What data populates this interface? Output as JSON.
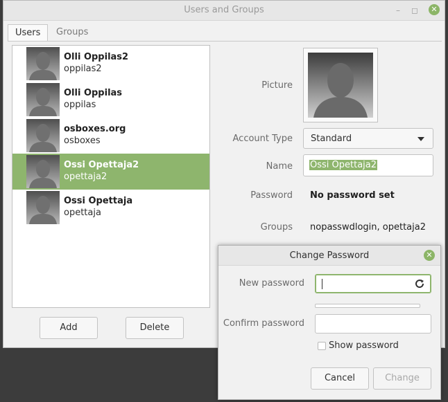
{
  "window": {
    "title": "Users and Groups"
  },
  "tabs": [
    {
      "label": "Users"
    },
    {
      "label": "Groups"
    }
  ],
  "users": [
    {
      "name": "Olli Oppilas2",
      "login": "oppilas2"
    },
    {
      "name": "Olli Oppilas",
      "login": "oppilas"
    },
    {
      "name": "osboxes.org",
      "login": "osboxes"
    },
    {
      "name": "Ossi Opettaja2",
      "login": "opettaja2"
    },
    {
      "name": "Ossi Opettaja",
      "login": "opettaja"
    }
  ],
  "selected_user_index": 3,
  "buttons": {
    "add": "Add",
    "delete": "Delete"
  },
  "details": {
    "picture_label": "Picture",
    "account_type_label": "Account Type",
    "account_type_value": "Standard",
    "name_label": "Name",
    "name_value": "Ossi Opettaja2",
    "password_label": "Password",
    "password_value": "No password set",
    "groups_label": "Groups",
    "groups_value": "nopasswdlogin, opettaja2"
  },
  "dialog": {
    "title": "Change Password",
    "new_password_label": "New password",
    "new_password_value": "",
    "confirm_password_label": "Confirm password",
    "confirm_password_value": "",
    "show_password_label": "Show password",
    "show_password_checked": false,
    "cancel": "Cancel",
    "change": "Change"
  },
  "colors": {
    "accent": "#8eb56d",
    "close": "#8cb567"
  },
  "icons": [
    "minimize-icon",
    "maximize-icon",
    "close-icon",
    "avatar-icon",
    "refresh-icon",
    "dropdown-arrow-icon",
    "checkbox-icon"
  ]
}
